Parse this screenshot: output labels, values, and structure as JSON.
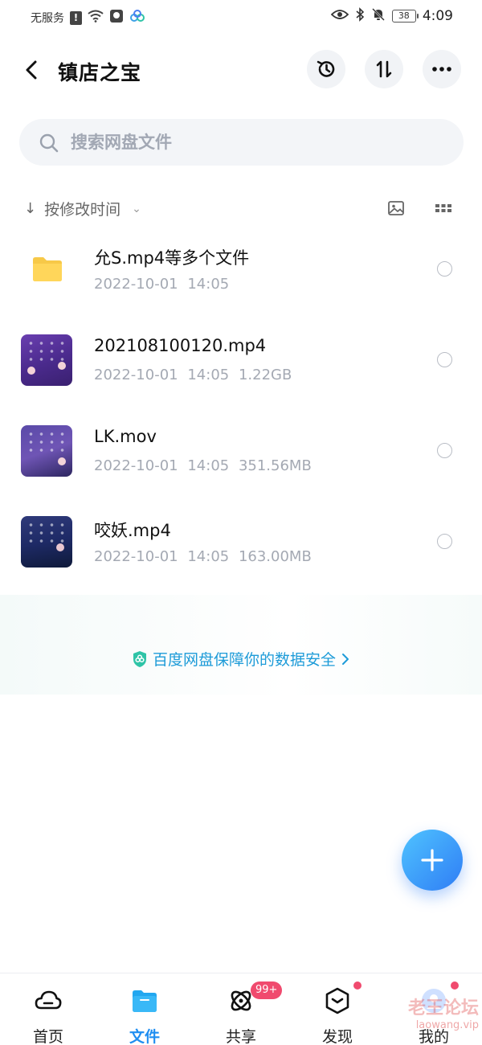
{
  "status_bar": {
    "carrier": "无服务",
    "battery": "38",
    "time": "4:09"
  },
  "header": {
    "title": "镇店之宝"
  },
  "search": {
    "placeholder": "搜索网盘文件"
  },
  "sort": {
    "label": "按修改时间"
  },
  "files": [
    {
      "name": "允S.mp4等多个文件",
      "date": "2022-10-01",
      "time": "14:05",
      "size": "",
      "type": "folder"
    },
    {
      "name": "202108100120.mp4",
      "date": "2022-10-01",
      "time": "14:05",
      "size": "1.22GB",
      "type": "video"
    },
    {
      "name": "LK.mov",
      "date": "2022-10-01",
      "time": "14:05",
      "size": "351.56MB",
      "type": "video"
    },
    {
      "name": "咬妖.mp4",
      "date": "2022-10-01",
      "time": "14:05",
      "size": "163.00MB",
      "type": "video"
    }
  ],
  "security_banner": {
    "text": "百度网盘保障你的数据安全"
  },
  "bottom_nav": {
    "items": [
      {
        "label": "首页"
      },
      {
        "label": "文件"
      },
      {
        "label": "共享"
      },
      {
        "label": "发现"
      },
      {
        "label": "我的"
      }
    ],
    "share_badge": "99+"
  },
  "watermark": {
    "line1": "老王论坛",
    "line2": "laowang.vip"
  },
  "colors": {
    "accent": "#1f8ef1",
    "badge": "#f04a6e",
    "secure_text": "#1d9bd8",
    "folder": "#f7c948"
  }
}
